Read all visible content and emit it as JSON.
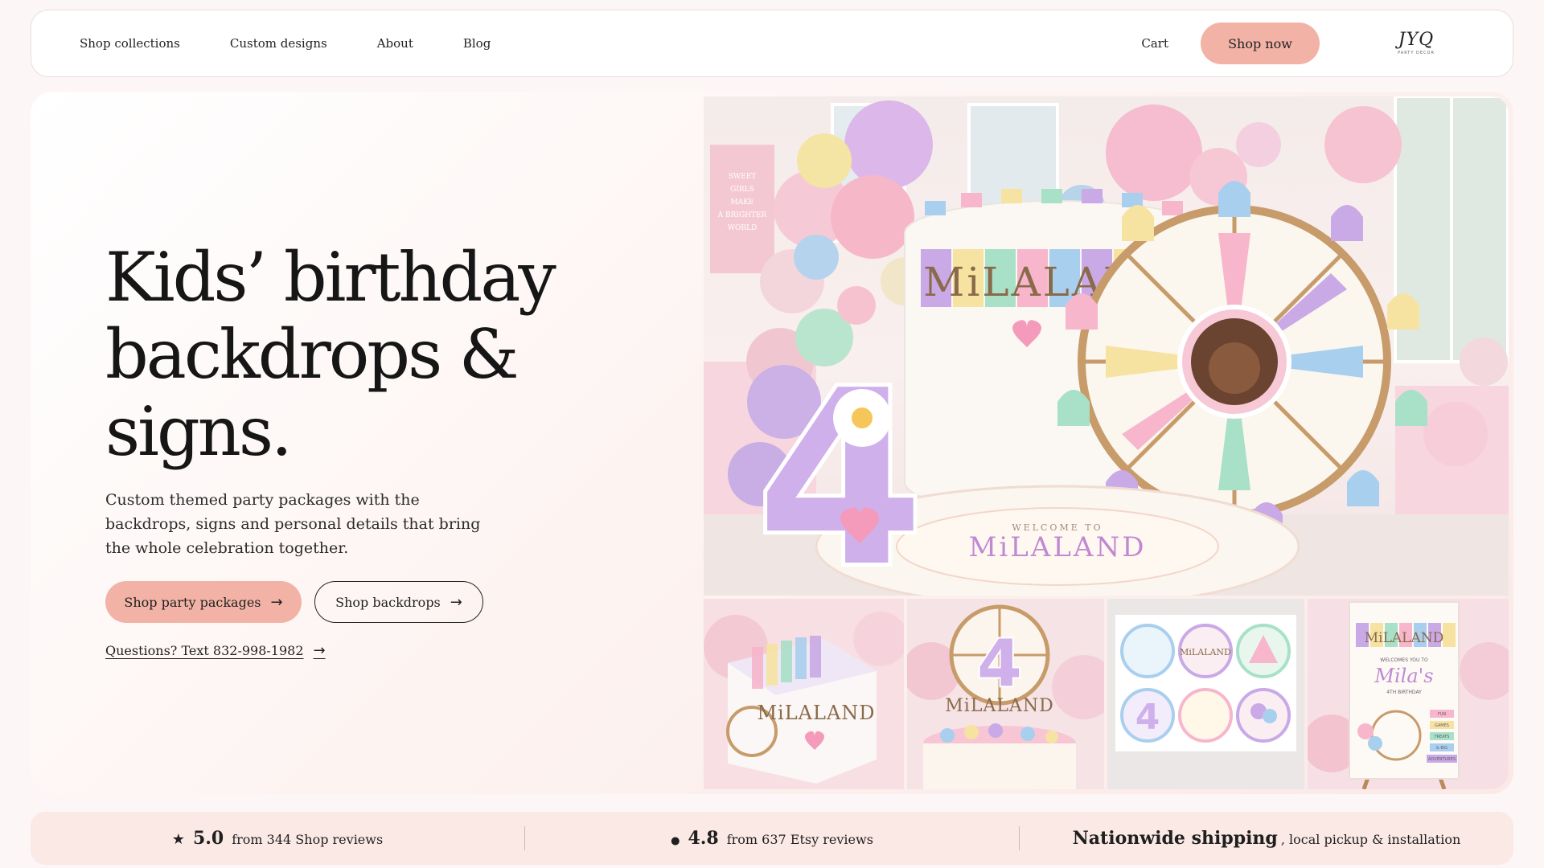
{
  "nav": {
    "links": [
      "Shop collections",
      "Custom designs",
      "About",
      "Blog"
    ],
    "cart": "Cart",
    "shop_now": "Shop now",
    "logo_mark": "JYQ",
    "logo_sub": "PARTY DECOR"
  },
  "hero": {
    "title_line1": "Kids’ birthday",
    "title_line2": "backdrops &",
    "title_line3": "signs.",
    "subtitle": "Custom themed party packages with the backdrops, signs and personal details that bring the whole celebration together.",
    "cta_primary": "Shop party packages",
    "cta_secondary": "Shop backdrops",
    "arrow": "→",
    "questions": "Questions? Text 832-998-1982"
  },
  "photo": {
    "backdrop_title": "MiLALAND",
    "floor_welcome": "WELCOME TO",
    "floor_title": "MiLALAND",
    "number": "4",
    "banner_lines": [
      "SWEET",
      "GIRLS",
      "MAKE",
      "A BRIGHTER",
      "WORLD"
    ]
  },
  "thumbs": {
    "box_title": "MiLALAND",
    "cake_title": "MiLALAND",
    "cake_number": "4",
    "sticker_title": "MiLALAND",
    "sticker_number": "4",
    "sign_title": "MiLALAND",
    "sign_welcome": "WELCOMES YOU TO",
    "sign_name": "Mila's",
    "sign_birthday": "4TH BIRTHDAY",
    "sign_tags": [
      "FUN",
      "GAMES",
      "TREATS",
      "& BIG",
      "ADVENTURES"
    ]
  },
  "stats": {
    "shop_icon": "★",
    "shop_rating": "5.0",
    "shop_reviews": "from 344 Shop reviews",
    "etsy_icon": "●",
    "etsy_rating": "4.8",
    "etsy_reviews": "from 637 Etsy reviews",
    "shipping": "Nationwide shipping",
    "shipping_sub": ", local pickup & installation"
  },
  "colors": {
    "accent": "#f2b3a6",
    "stats_bg": "#fbe9e6",
    "pastel_pink": "#f7b6cc",
    "pastel_lilac": "#c9a9e6",
    "pastel_mint": "#a8e0c8",
    "pastel_blue": "#a9cfee",
    "pastel_yellow": "#f6e3a1"
  }
}
